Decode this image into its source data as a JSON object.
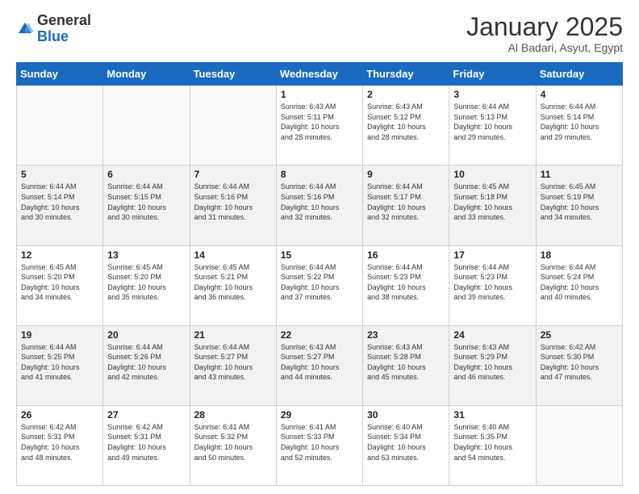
{
  "header": {
    "logo_general": "General",
    "logo_blue": "Blue",
    "month_title": "January 2025",
    "subtitle": "Al Badari, Asyut, Egypt"
  },
  "days_of_week": [
    "Sunday",
    "Monday",
    "Tuesday",
    "Wednesday",
    "Thursday",
    "Friday",
    "Saturday"
  ],
  "weeks": [
    {
      "alt": false,
      "days": [
        {
          "num": "",
          "info": ""
        },
        {
          "num": "",
          "info": ""
        },
        {
          "num": "",
          "info": ""
        },
        {
          "num": "1",
          "info": "Sunrise: 6:43 AM\nSunset: 5:11 PM\nDaylight: 10 hours\nand 28 minutes."
        },
        {
          "num": "2",
          "info": "Sunrise: 6:43 AM\nSunset: 5:12 PM\nDaylight: 10 hours\nand 28 minutes."
        },
        {
          "num": "3",
          "info": "Sunrise: 6:44 AM\nSunset: 5:13 PM\nDaylight: 10 hours\nand 29 minutes."
        },
        {
          "num": "4",
          "info": "Sunrise: 6:44 AM\nSunset: 5:14 PM\nDaylight: 10 hours\nand 29 minutes."
        }
      ]
    },
    {
      "alt": true,
      "days": [
        {
          "num": "5",
          "info": "Sunrise: 6:44 AM\nSunset: 5:14 PM\nDaylight: 10 hours\nand 30 minutes."
        },
        {
          "num": "6",
          "info": "Sunrise: 6:44 AM\nSunset: 5:15 PM\nDaylight: 10 hours\nand 30 minutes."
        },
        {
          "num": "7",
          "info": "Sunrise: 6:44 AM\nSunset: 5:16 PM\nDaylight: 10 hours\nand 31 minutes."
        },
        {
          "num": "8",
          "info": "Sunrise: 6:44 AM\nSunset: 5:16 PM\nDaylight: 10 hours\nand 32 minutes."
        },
        {
          "num": "9",
          "info": "Sunrise: 6:44 AM\nSunset: 5:17 PM\nDaylight: 10 hours\nand 32 minutes."
        },
        {
          "num": "10",
          "info": "Sunrise: 6:45 AM\nSunset: 5:18 PM\nDaylight: 10 hours\nand 33 minutes."
        },
        {
          "num": "11",
          "info": "Sunrise: 6:45 AM\nSunset: 5:19 PM\nDaylight: 10 hours\nand 34 minutes."
        }
      ]
    },
    {
      "alt": false,
      "days": [
        {
          "num": "12",
          "info": "Sunrise: 6:45 AM\nSunset: 5:20 PM\nDaylight: 10 hours\nand 34 minutes."
        },
        {
          "num": "13",
          "info": "Sunrise: 6:45 AM\nSunset: 5:20 PM\nDaylight: 10 hours\nand 35 minutes."
        },
        {
          "num": "14",
          "info": "Sunrise: 6:45 AM\nSunset: 5:21 PM\nDaylight: 10 hours\nand 36 minutes."
        },
        {
          "num": "15",
          "info": "Sunrise: 6:44 AM\nSunset: 5:22 PM\nDaylight: 10 hours\nand 37 minutes."
        },
        {
          "num": "16",
          "info": "Sunrise: 6:44 AM\nSunset: 5:23 PM\nDaylight: 10 hours\nand 38 minutes."
        },
        {
          "num": "17",
          "info": "Sunrise: 6:44 AM\nSunset: 5:23 PM\nDaylight: 10 hours\nand 39 minutes."
        },
        {
          "num": "18",
          "info": "Sunrise: 6:44 AM\nSunset: 5:24 PM\nDaylight: 10 hours\nand 40 minutes."
        }
      ]
    },
    {
      "alt": true,
      "days": [
        {
          "num": "19",
          "info": "Sunrise: 6:44 AM\nSunset: 5:25 PM\nDaylight: 10 hours\nand 41 minutes."
        },
        {
          "num": "20",
          "info": "Sunrise: 6:44 AM\nSunset: 5:26 PM\nDaylight: 10 hours\nand 42 minutes."
        },
        {
          "num": "21",
          "info": "Sunrise: 6:44 AM\nSunset: 5:27 PM\nDaylight: 10 hours\nand 43 minutes."
        },
        {
          "num": "22",
          "info": "Sunrise: 6:43 AM\nSunset: 5:27 PM\nDaylight: 10 hours\nand 44 minutes."
        },
        {
          "num": "23",
          "info": "Sunrise: 6:43 AM\nSunset: 5:28 PM\nDaylight: 10 hours\nand 45 minutes."
        },
        {
          "num": "24",
          "info": "Sunrise: 6:43 AM\nSunset: 5:29 PM\nDaylight: 10 hours\nand 46 minutes."
        },
        {
          "num": "25",
          "info": "Sunrise: 6:42 AM\nSunset: 5:30 PM\nDaylight: 10 hours\nand 47 minutes."
        }
      ]
    },
    {
      "alt": false,
      "days": [
        {
          "num": "26",
          "info": "Sunrise: 6:42 AM\nSunset: 5:31 PM\nDaylight: 10 hours\nand 48 minutes."
        },
        {
          "num": "27",
          "info": "Sunrise: 6:42 AM\nSunset: 5:31 PM\nDaylight: 10 hours\nand 49 minutes."
        },
        {
          "num": "28",
          "info": "Sunrise: 6:41 AM\nSunset: 5:32 PM\nDaylight: 10 hours\nand 50 minutes."
        },
        {
          "num": "29",
          "info": "Sunrise: 6:41 AM\nSunset: 5:33 PM\nDaylight: 10 hours\nand 52 minutes."
        },
        {
          "num": "30",
          "info": "Sunrise: 6:40 AM\nSunset: 5:34 PM\nDaylight: 10 hours\nand 53 minutes."
        },
        {
          "num": "31",
          "info": "Sunrise: 6:40 AM\nSunset: 5:35 PM\nDaylight: 10 hours\nand 54 minutes."
        },
        {
          "num": "",
          "info": ""
        }
      ]
    }
  ]
}
